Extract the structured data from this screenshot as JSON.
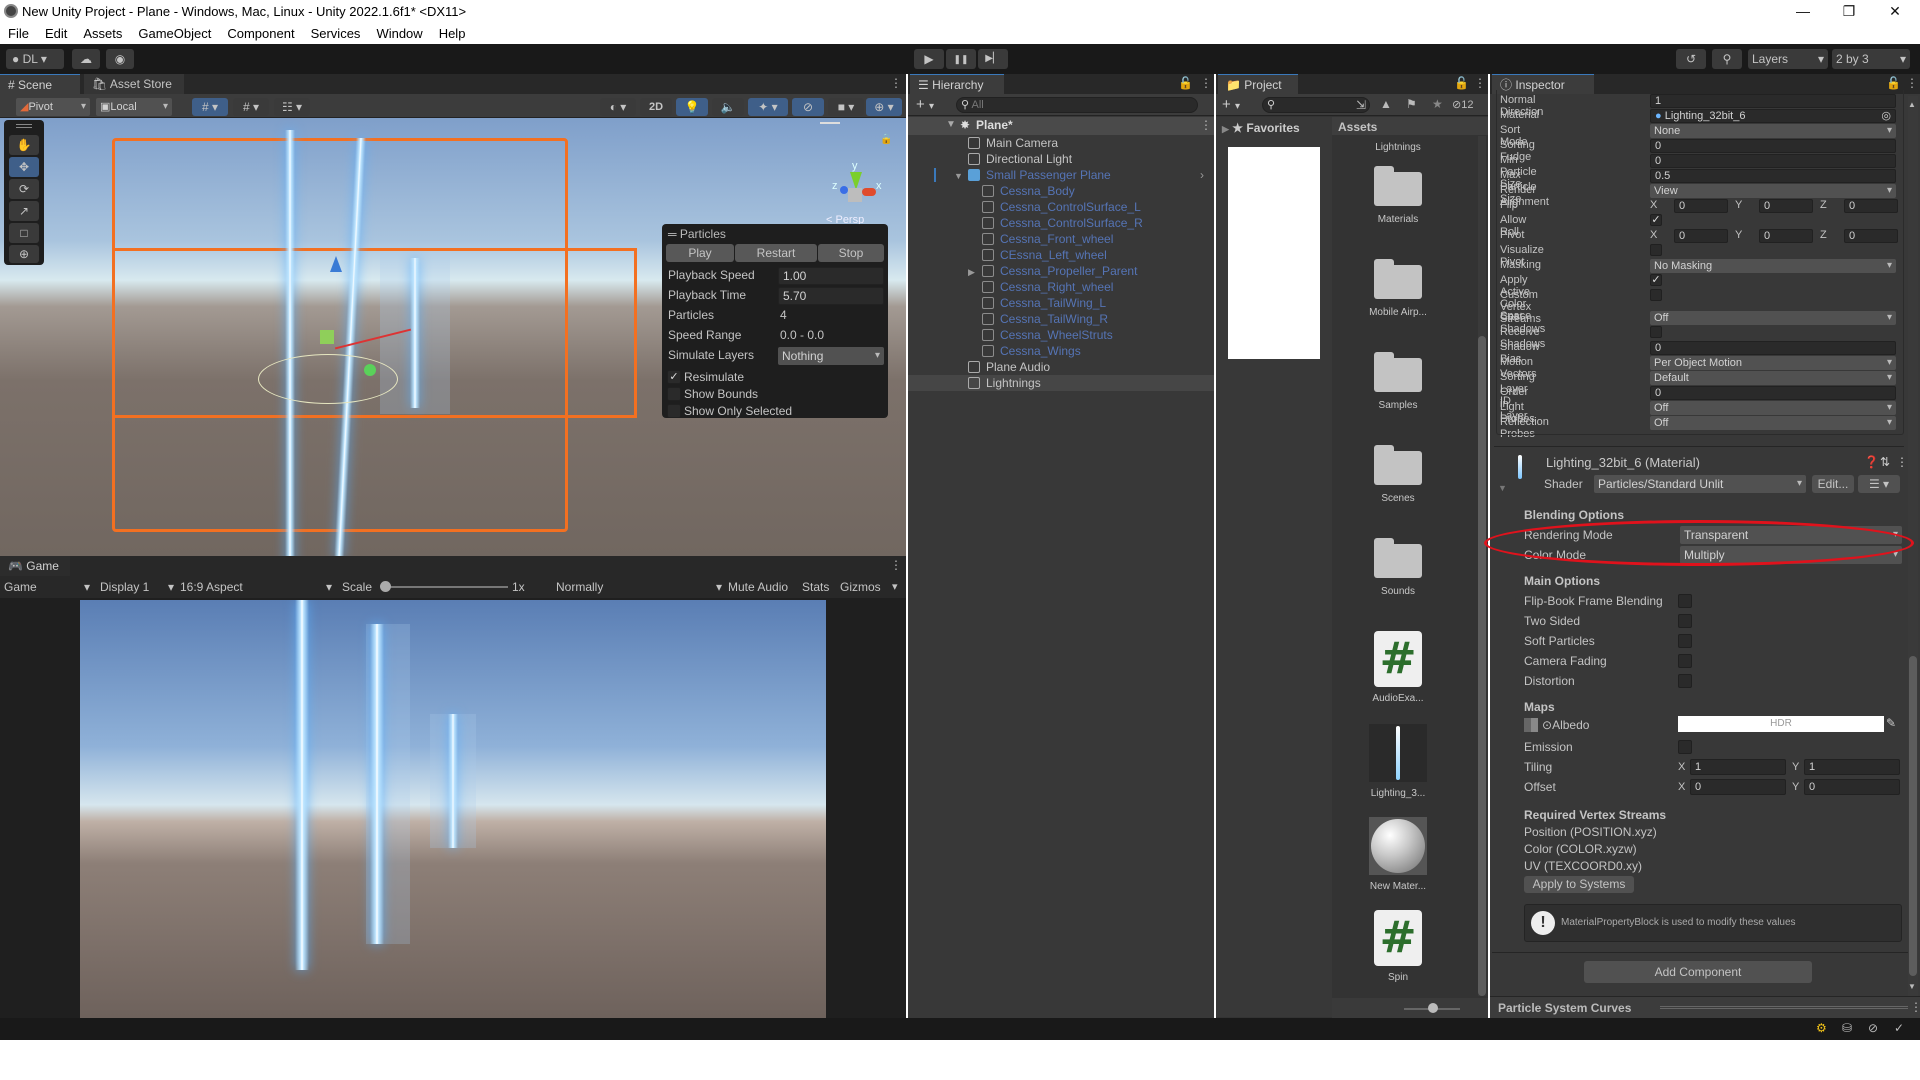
{
  "window": {
    "title": "New Unity Project - Plane - Windows, Mac, Linux - Unity 2022.1.6f1* <DX11>",
    "controls": {
      "minimize": "—",
      "maximize": "❐",
      "close": "✕"
    }
  },
  "menu": [
    "File",
    "Edit",
    "Assets",
    "GameObject",
    "Component",
    "Services",
    "Window",
    "Help"
  ],
  "toolbar": {
    "account": "DL",
    "play_icons": {
      "play": "▶",
      "pause": "❚❚",
      "step": "▶▏"
    },
    "layers": "Layers",
    "layout": "2 by 3"
  },
  "scene": {
    "tabs": [
      "Scene",
      "Asset Store"
    ],
    "pivot": "Pivot",
    "local": "Local",
    "mode_2d": "2D",
    "persp": "< Persp",
    "gizmo_axes": {
      "x": "x",
      "y": "y",
      "z": "z"
    },
    "particles": {
      "title": "Particles",
      "buttons": [
        "Play",
        "Restart",
        "Stop"
      ],
      "playback_speed_label": "Playback Speed",
      "playback_speed": "1.00",
      "playback_time_label": "Playback Time",
      "playback_time": "5.70",
      "particles_label": "Particles",
      "particles": "4",
      "speed_range_label": "Speed Range",
      "speed_range": "0.0 - 0.0",
      "simulate_layers_label": "Simulate Layers",
      "simulate_layers": "Nothing",
      "resimulate": "Resimulate",
      "resimulate_checked": true,
      "show_bounds": "Show Bounds",
      "show_bounds_checked": false,
      "show_only_selected": "Show Only Selected",
      "show_only_selected_checked": false
    }
  },
  "game": {
    "tab": "Game",
    "mode": "Game",
    "display": "Display 1",
    "aspect": "16:9 Aspect",
    "scale_label": "Scale",
    "scale_value": "1x",
    "play_focus": "Normally",
    "mute_audio": "Mute Audio",
    "stats": "Stats",
    "gizmos": "Gizmos"
  },
  "hierarchy": {
    "tab": "Hierarchy",
    "search_placeholder": "All",
    "scene": "Plane*",
    "items": [
      {
        "label": "Main Camera",
        "depth": 1,
        "style": "normal"
      },
      {
        "label": "Directional Light",
        "depth": 1,
        "style": "normal"
      },
      {
        "label": "Small Passenger Plane",
        "depth": 1,
        "style": "prefab",
        "expanded": true
      },
      {
        "label": "Cessna_Body",
        "depth": 2,
        "style": "prefab"
      },
      {
        "label": "Cessna_ControlSurface_L",
        "depth": 2,
        "style": "prefab"
      },
      {
        "label": "Cessna_ControlSurface_R",
        "depth": 2,
        "style": "prefab"
      },
      {
        "label": "Cessna_Front_wheel",
        "depth": 2,
        "style": "prefab"
      },
      {
        "label": "CEssna_Left_wheel",
        "depth": 2,
        "style": "prefab"
      },
      {
        "label": "Cessna_Propeller_Parent",
        "depth": 2,
        "style": "prefab",
        "collapsed": true
      },
      {
        "label": "Cessna_Right_wheel",
        "depth": 2,
        "style": "prefab"
      },
      {
        "label": "Cessna_TailWing_L",
        "depth": 2,
        "style": "prefab"
      },
      {
        "label": "Cessna_TailWing_R",
        "depth": 2,
        "style": "prefab"
      },
      {
        "label": "Cessna_WheelStruts",
        "depth": 2,
        "style": "prefab"
      },
      {
        "label": "Cessna_Wings",
        "depth": 2,
        "style": "prefab"
      },
      {
        "label": "Plane Audio",
        "depth": 1,
        "style": "normal"
      },
      {
        "label": "Lightnings",
        "depth": 1,
        "style": "selected"
      }
    ]
  },
  "project": {
    "tab": "Project",
    "hidden_count": "12",
    "favorites": "Favorites",
    "breadcrumb": "Assets",
    "assets": [
      {
        "name": "Lightnings",
        "type": "folder-label"
      },
      {
        "name": "Materials",
        "type": "folder"
      },
      {
        "name": "Mobile Airp...",
        "type": "folder"
      },
      {
        "name": "Samples",
        "type": "folder"
      },
      {
        "name": "Scenes",
        "type": "folder"
      },
      {
        "name": "Sounds",
        "type": "folder"
      },
      {
        "name": "AudioExa...",
        "type": "script"
      },
      {
        "name": "Lighting_3...",
        "type": "texture"
      },
      {
        "name": "New Mater...",
        "type": "material"
      },
      {
        "name": "Spin",
        "type": "script"
      }
    ]
  },
  "inspector": {
    "tab": "Inspector",
    "renderer": [
      {
        "label": "Normal Direction",
        "type": "field",
        "value": "1"
      },
      {
        "label": "Material",
        "type": "object",
        "value": "Lighting_32bit_6"
      },
      {
        "label": "Sort Mode",
        "type": "dropdown",
        "value": "None"
      },
      {
        "label": "Sorting Fudge",
        "type": "field",
        "value": "0"
      },
      {
        "label": "Min Particle Size",
        "type": "field",
        "value": "0"
      },
      {
        "label": "Max Particle Size",
        "type": "field",
        "value": "0.5"
      },
      {
        "label": "Render Alignment",
        "type": "dropdown",
        "value": "View"
      },
      {
        "label": "Flip",
        "type": "xyz",
        "value": [
          "0",
          "0",
          "0"
        ]
      },
      {
        "label": "Allow Roll",
        "type": "checkbox",
        "value": true
      },
      {
        "label": "Pivot",
        "type": "xyz",
        "value": [
          "0",
          "0",
          "0"
        ]
      },
      {
        "label": "Visualize Pivot",
        "type": "checkbox",
        "value": false
      },
      {
        "label": "Masking",
        "type": "dropdown",
        "value": "No Masking"
      },
      {
        "label": "Apply Active Color Space",
        "type": "checkbox",
        "value": true
      },
      {
        "label": "Custom Vertex Streams",
        "type": "checkbox",
        "value": false
      },
      {
        "label": "Cast Shadows",
        "type": "dropdown",
        "value": "Off"
      },
      {
        "label": "Receive Shadows",
        "type": "checkbox",
        "value": false
      },
      {
        "label": "Shadow Bias",
        "type": "field",
        "value": "0"
      },
      {
        "label": "Motion Vectors",
        "type": "dropdown",
        "value": "Per Object Motion"
      },
      {
        "label": "Sorting Layer ID",
        "type": "dropdown",
        "value": "Default"
      },
      {
        "label": "Order in Layer",
        "type": "field",
        "value": "0"
      },
      {
        "label": "Light Probes",
        "type": "dropdown",
        "value": "Off"
      },
      {
        "label": "Reflection Probes",
        "type": "dropdown",
        "value": "Off"
      }
    ],
    "material": {
      "title": "Lighting_32bit_6 (Material)",
      "shader_label": "Shader",
      "shader": "Particles/Standard Unlit",
      "edit": "Edit...",
      "blending_header": "Blending Options",
      "rendering_mode_label": "Rendering Mode",
      "rendering_mode": "Transparent",
      "color_mode_label": "Color Mode",
      "color_mode": "Multiply",
      "main_header": "Main Options",
      "main_options": [
        {
          "label": "Flip-Book Frame Blending",
          "value": false
        },
        {
          "label": "Two Sided",
          "value": false
        },
        {
          "label": "Soft Particles",
          "value": false
        },
        {
          "label": "Camera Fading",
          "value": false
        },
        {
          "label": "Distortion",
          "value": false
        }
      ],
      "maps_header": "Maps",
      "albedo_label": "Albedo",
      "albedo_hdr": "HDR",
      "emission_label": "Emission",
      "tiling_label": "Tiling",
      "tiling": {
        "x": "1",
        "y": "1"
      },
      "offset_label": "Offset",
      "offset": {
        "x": "0",
        "y": "0"
      },
      "streams_header": "Required Vertex Streams",
      "streams": [
        "Position (POSITION.xyz)",
        "Color (COLOR.xyzw)",
        "UV (TEXCOORD0.xy)"
      ],
      "apply_button": "Apply to Systems",
      "info": "MaterialPropertyBlock is used to modify these values"
    },
    "add_component": "Add Component",
    "curves": "Particle System Curves"
  },
  "colors": {
    "accent_blue": "#3a79bb",
    "selection_orange": "#f37021",
    "annotation_red": "#e0121c",
    "prefab_text": "#5574b5"
  }
}
